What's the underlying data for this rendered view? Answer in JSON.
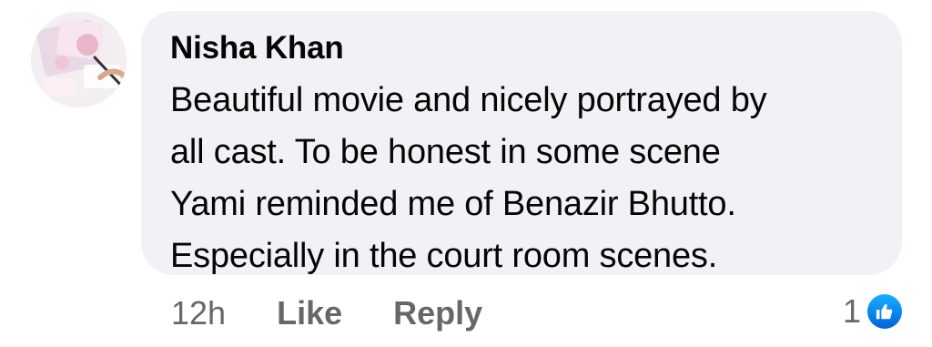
{
  "comment": {
    "author": "Nisha Khan",
    "avatar_icon": "profile-photo",
    "lines": [
      "Beautiful movie and nicely portrayed by",
      "all cast.  To be honest in some scene",
      "Yami reminded me of Benazir Bhutto.",
      "Especially in the court room scenes."
    ],
    "time": "12h",
    "like_label": "Like",
    "reply_label": "Reply",
    "reaction_count": "1",
    "reaction_icon": "like-thumb-icon"
  },
  "colors": {
    "bubble_bg": "#f0f2f5",
    "meta_text": "#65676b",
    "like_blue": "#1877f2"
  }
}
